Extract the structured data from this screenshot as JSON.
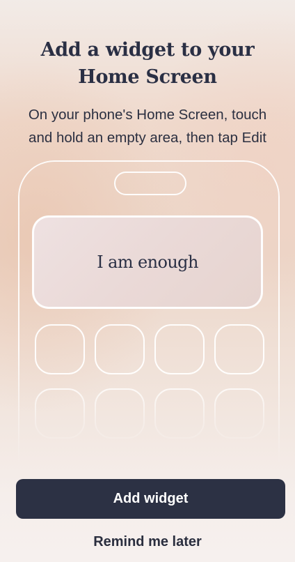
{
  "title_line1": "Add a widget to your",
  "title_line2": "Home Screen",
  "subtitle_line1": "On your phone's Home Screen, touch",
  "subtitle_line2": "and hold an empty area, then tap Edit",
  "widget_text": "I am enough",
  "primary_button": "Add widget",
  "secondary_button": "Remind me later",
  "colors": {
    "primary_button_bg": "#2c3144",
    "text_dark": "#2a2f44",
    "outline": "#ffffff"
  }
}
